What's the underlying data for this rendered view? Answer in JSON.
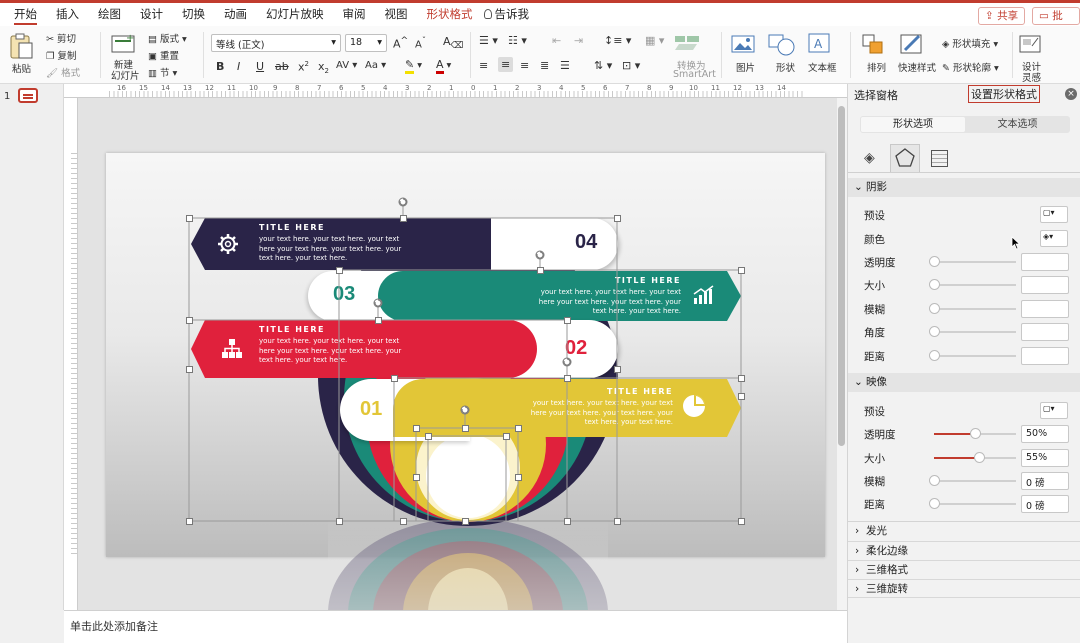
{
  "menu": [
    "开始",
    "插入",
    "绘图",
    "设计",
    "切换",
    "动画",
    "幻灯片放映",
    "审阅",
    "视图",
    "形状格式",
    "告诉我"
  ],
  "actions": {
    "share": "共享",
    "comment": "批注"
  },
  "ribbon": {
    "paste": "粘贴",
    "cut": "剪切",
    "copy": "复制",
    "format": "格式",
    "new_slide_1": "新建",
    "new_slide_2": "幻灯片",
    "layout": "版式",
    "reset": "重置",
    "section": "节",
    "font_name": "等线 (正文)",
    "font_size": "18",
    "convert_1": "转换为",
    "convert_2": "SmartArt",
    "picture": "图片",
    "shape": "形状",
    "textbox": "文本框",
    "arrange": "排列",
    "quick_styles": "快速样式",
    "shape_fill": "形状填充",
    "shape_outline": "形状轮廓",
    "designer_1": "设计",
    "designer_2": "灵感"
  },
  "slide_number": "1",
  "notes_placeholder": "单击此处添加备注",
  "slide": {
    "items": [
      {
        "num": "04",
        "title": "TITLE HERE",
        "body": "your text here. your text here. your text here your text here. your text here. your text here. your text here."
      },
      {
        "num": "03",
        "title": "TITLE HERE",
        "body": "your text here. your text here. your text here your text here. your text here. your text here. your text here."
      },
      {
        "num": "02",
        "title": "TITLE HERE",
        "body": "your text here. your text here. your text here your text here. your text here. your text here. your text here."
      },
      {
        "num": "01",
        "title": "TITLE HERE",
        "body": "your text here. your text here. your text here your text here. your text here. your text here. your text here."
      }
    ],
    "colors": {
      "navy": "#2a2448",
      "teal": "#1a8a78",
      "red": "#e0213c",
      "yellow": "#e2c637"
    }
  },
  "panel": {
    "tab_selection": "选择窗格",
    "tab_format": "设置形状格式",
    "sub_shape": "形状选项",
    "sub_text": "文本选项",
    "shadow": {
      "header": "阴影",
      "preset": "预设",
      "color": "颜色",
      "transparency": "透明度",
      "size": "大小",
      "blur": "模糊",
      "angle": "角度",
      "distance": "距离"
    },
    "reflection": {
      "header": "映像",
      "preset": "预设",
      "transparency": "透明度",
      "transparency_val": "50%",
      "size": "大小",
      "size_val": "55%",
      "blur": "模糊",
      "blur_val": "0 磅",
      "distance": "距离",
      "distance_val": "0 磅"
    },
    "collapsed": [
      "发光",
      "柔化边缘",
      "三维格式",
      "三维旋转"
    ]
  }
}
